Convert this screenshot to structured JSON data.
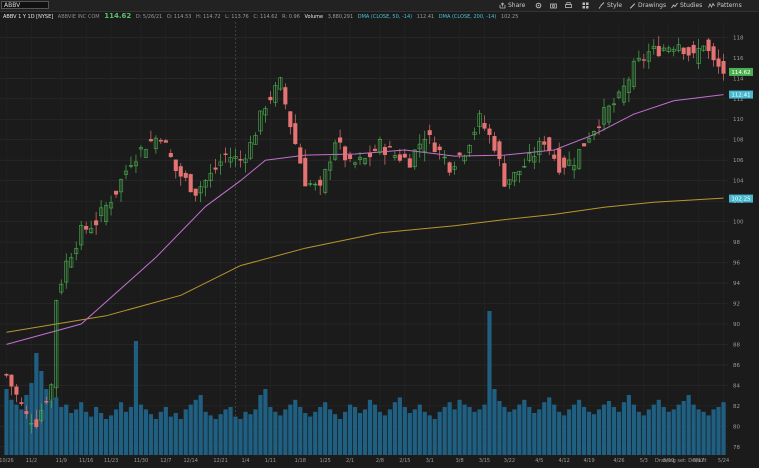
{
  "toolbar": {
    "symbol": "ABBV",
    "share": "Share",
    "style": "Style",
    "drawings": "Drawings",
    "studies": "Studies",
    "patterns": "Patterns"
  },
  "info": {
    "title": "ABBV 1 Y 1D [NYSE]",
    "name": "ABBVIE INC COM",
    "last": "114.62",
    "date": "D: 5/26/21",
    "open": "O: 114.53",
    "high": "H: 114.72",
    "low": "L: 113.76",
    "close": "C: 114.62",
    "change": "R: 0.96",
    "volume_label": "Volume",
    "volume": "3,880,291",
    "dma50": "DMA (CLOSE, 50, -14)",
    "dma50_value": "112.41",
    "dma200": "DMA (CLOSE, 200, -14)",
    "dma200_value": "102.25"
  },
  "footer": {
    "drawing_set": "Drawing set: Default"
  },
  "colors": {
    "up": "#4caf50",
    "down": "#e57373",
    "volume": "#1f5f82",
    "dma50": "#c36fd1",
    "dma200": "#47b8cf",
    "dma_slow": "#b8962e"
  },
  "chart_data": {
    "type": "candlestick",
    "y_axis_ticks": [
      78,
      80,
      82,
      84,
      86,
      88,
      90,
      92,
      94,
      96,
      98,
      100,
      102,
      104,
      106,
      108,
      110,
      112,
      114,
      116,
      118
    ],
    "ylim": [
      77.2,
      119.5
    ],
    "x_ticks": [
      "10/26",
      "11/2",
      "11/9",
      "11/16",
      "11/23",
      "11/30",
      "12/7",
      "12/14",
      "12/21",
      "1/4",
      "1/11",
      "1/18",
      "1/25",
      "2/1",
      "2/8",
      "2/15",
      "3/1",
      "3/8",
      "3/15",
      "3/22",
      "4/5",
      "4/12",
      "4/19",
      "4/26",
      "5/3",
      "5/10",
      "5/17",
      "5/24"
    ],
    "price_labels": [
      {
        "value": 114.62,
        "text": "114.62"
      },
      {
        "value": 112.41,
        "text": "112.41"
      },
      {
        "value": 102.25,
        "text": "102.25"
      }
    ],
    "anchors": [
      {
        "i": 0,
        "c": 85.0
      },
      {
        "i": 4,
        "c": 81.0
      },
      {
        "i": 6,
        "c": 80.5
      },
      {
        "i": 9,
        "c": 84.0
      },
      {
        "i": 10,
        "c": 92.5
      },
      {
        "i": 12,
        "c": 96.0
      },
      {
        "i": 15,
        "c": 99.0
      },
      {
        "i": 18,
        "c": 100.0
      },
      {
        "i": 22,
        "c": 103.0
      },
      {
        "i": 25,
        "c": 106.0
      },
      {
        "i": 28,
        "c": 107.5
      },
      {
        "i": 31,
        "c": 108.5
      },
      {
        "i": 34,
        "c": 105.0
      },
      {
        "i": 38,
        "c": 103.0
      },
      {
        "i": 41,
        "c": 104.5
      },
      {
        "i": 44,
        "c": 106.5
      },
      {
        "i": 47,
        "c": 106.0
      },
      {
        "i": 49,
        "c": 107.5
      },
      {
        "i": 52,
        "c": 111.5
      },
      {
        "i": 55,
        "c": 113.5
      },
      {
        "i": 57,
        "c": 109.5
      },
      {
        "i": 60,
        "c": 104.0
      },
      {
        "i": 63,
        "c": 103.0
      },
      {
        "i": 66,
        "c": 108.0
      },
      {
        "i": 69,
        "c": 105.5
      },
      {
        "i": 72,
        "c": 106.0
      },
      {
        "i": 75,
        "c": 107.5
      },
      {
        "i": 78,
        "c": 106.5
      },
      {
        "i": 81,
        "c": 106.0
      },
      {
        "i": 84,
        "c": 108.5
      },
      {
        "i": 86,
        "c": 107.5
      },
      {
        "i": 89,
        "c": 105.5
      },
      {
        "i": 92,
        "c": 107.0
      },
      {
        "i": 95,
        "c": 110.0
      },
      {
        "i": 98,
        "c": 107.5
      },
      {
        "i": 100,
        "c": 104.0
      },
      {
        "i": 102,
        "c": 104.5
      },
      {
        "i": 105,
        "c": 106.0
      },
      {
        "i": 108,
        "c": 108.0
      },
      {
        "i": 111,
        "c": 105.5
      },
      {
        "i": 114,
        "c": 106.0
      },
      {
        "i": 117,
        "c": 108.5
      },
      {
        "i": 120,
        "c": 110.5
      },
      {
        "i": 123,
        "c": 112.0
      },
      {
        "i": 126,
        "c": 115.0
      },
      {
        "i": 129,
        "c": 116.5
      },
      {
        "i": 132,
        "c": 117.0
      },
      {
        "i": 135,
        "c": 117.5
      },
      {
        "i": 138,
        "c": 116.0
      },
      {
        "i": 140,
        "c": 117.5
      },
      {
        "i": 142,
        "c": 115.5
      },
      {
        "i": 144,
        "c": 114.62
      }
    ],
    "n_bars": 145,
    "dma50_path": [
      [
        0,
        88.0
      ],
      [
        15,
        90.0
      ],
      [
        30,
        96.5
      ],
      [
        40,
        101.5
      ],
      [
        47,
        104.0
      ],
      [
        52,
        106.0
      ],
      [
        60,
        106.5
      ],
      [
        70,
        106.6
      ],
      [
        80,
        107.0
      ],
      [
        90,
        106.4
      ],
      [
        100,
        106.5
      ],
      [
        110,
        107.0
      ],
      [
        118,
        108.5
      ],
      [
        126,
        110.5
      ],
      [
        134,
        111.8
      ],
      [
        144,
        112.41
      ]
    ],
    "dma200_path": [
      [
        0,
        89.0
      ],
      [
        20,
        90.5
      ],
      [
        35,
        92.5
      ],
      [
        47,
        95.5
      ],
      [
        60,
        97.2
      ],
      [
        75,
        98.6
      ],
      [
        90,
        99.4
      ],
      [
        100,
        100.0
      ],
      [
        110,
        100.5
      ],
      [
        120,
        101.2
      ],
      [
        130,
        101.8
      ],
      [
        144,
        102.25
      ]
    ],
    "dma_slow_path": [
      [
        0,
        89.2
      ],
      [
        20,
        90.8
      ],
      [
        35,
        92.8
      ],
      [
        47,
        95.7
      ],
      [
        60,
        97.4
      ],
      [
        75,
        98.9
      ],
      [
        90,
        99.6
      ],
      [
        100,
        100.2
      ],
      [
        110,
        100.7
      ],
      [
        120,
        101.4
      ],
      [
        130,
        101.9
      ],
      [
        144,
        102.3
      ]
    ],
    "volume_relative": [
      0.55,
      0.46,
      0.42,
      0.38,
      0.5,
      0.6,
      0.85,
      0.7,
      0.55,
      0.45,
      0.48,
      0.4,
      0.42,
      0.35,
      0.38,
      0.44,
      0.36,
      0.32,
      0.4,
      0.35,
      0.3,
      0.33,
      0.38,
      0.44,
      0.36,
      0.4,
      0.95,
      0.42,
      0.38,
      0.34,
      0.3,
      0.36,
      0.4,
      0.32,
      0.35,
      0.3,
      0.38,
      0.42,
      0.46,
      0.5,
      0.36,
      0.33,
      0.3,
      0.34,
      0.38,
      0.4,
      0.32,
      0.3,
      0.36,
      0.34,
      0.38,
      0.5,
      0.55,
      0.4,
      0.36,
      0.33,
      0.38,
      0.42,
      0.46,
      0.4,
      0.35,
      0.32,
      0.36,
      0.4,
      0.44,
      0.38,
      0.34,
      0.3,
      0.36,
      0.42,
      0.4,
      0.35,
      0.38,
      0.46,
      0.42,
      0.36,
      0.33,
      0.38,
      0.44,
      0.48,
      0.4,
      0.35,
      0.38,
      0.42,
      0.36,
      0.33,
      0.3,
      0.36,
      0.4,
      0.44,
      0.38,
      0.46,
      0.42,
      0.4,
      0.36,
      0.38,
      0.42,
      1.2,
      0.55,
      0.45,
      0.4,
      0.36,
      0.38,
      0.42,
      0.46,
      0.4,
      0.35,
      0.38,
      0.44,
      0.48,
      0.42,
      0.36,
      0.33,
      0.38,
      0.42,
      0.46,
      0.4,
      0.36,
      0.34,
      0.38,
      0.42,
      0.45,
      0.4,
      0.36,
      0.44,
      0.5,
      0.42,
      0.36,
      0.33,
      0.38,
      0.42,
      0.46,
      0.4,
      0.36,
      0.38,
      0.42,
      0.45,
      0.5,
      0.42,
      0.38,
      0.36,
      0.33,
      0.38,
      0.4,
      0.44
    ]
  }
}
